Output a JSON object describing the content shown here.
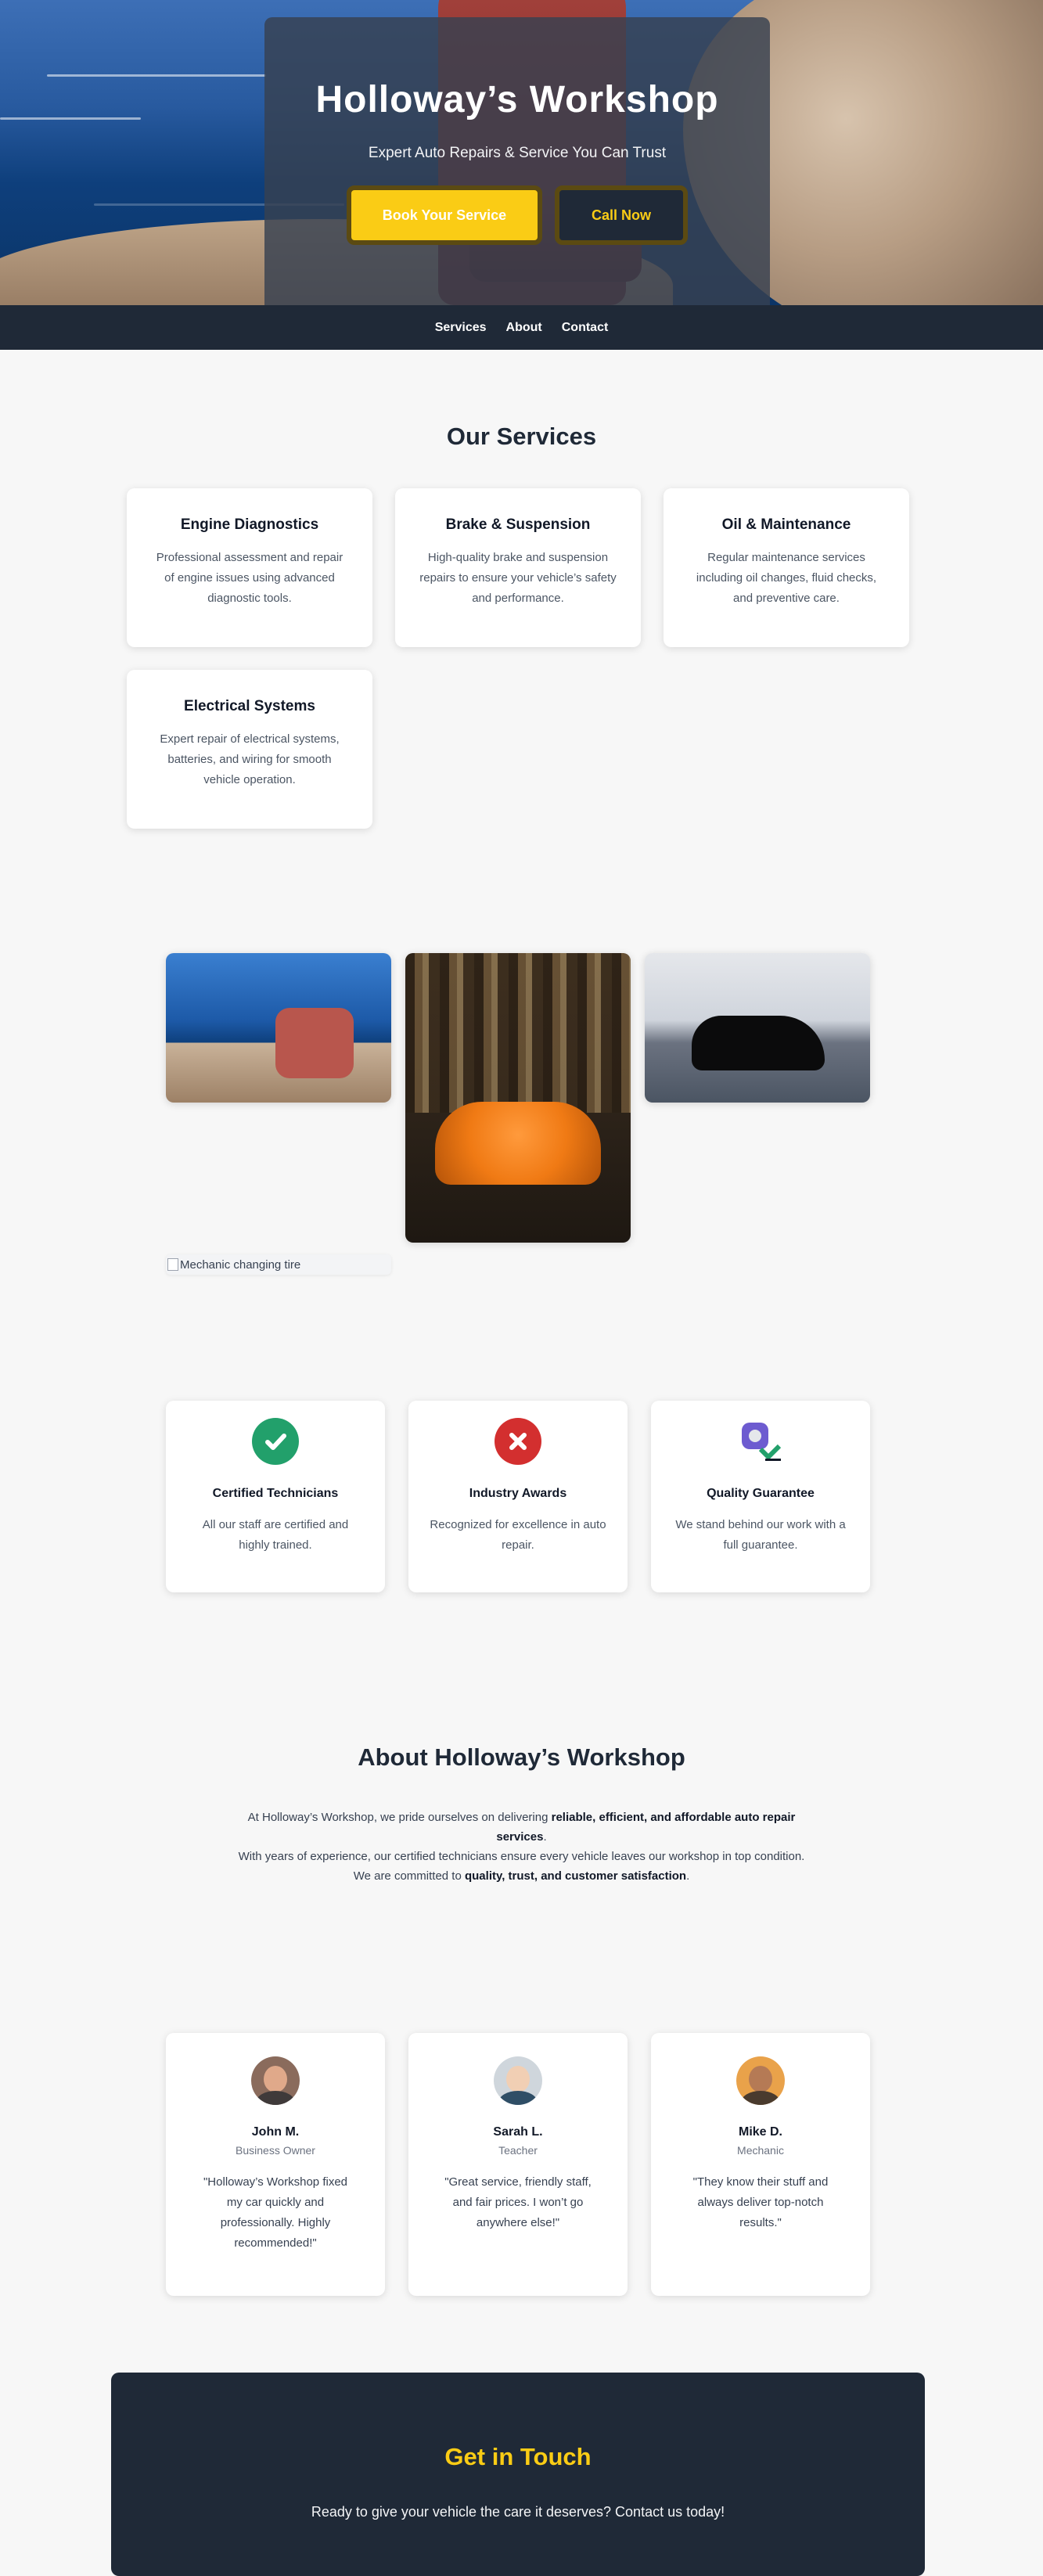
{
  "hero": {
    "title": "Holloway’s Workshop",
    "subtitle": "Expert Auto Repairs & Service You Can Trust",
    "book_label": "Book Your Service",
    "call_label": "Call Now"
  },
  "nav": {
    "items": [
      "Services",
      "About",
      "Contact"
    ]
  },
  "services": {
    "title": "Our Services",
    "items": [
      {
        "title": "Engine Diagnostics",
        "desc": "Professional assessment and repair of engine issues using advanced diagnostic tools."
      },
      {
        "title": "Brake & Suspension",
        "desc": "High-quality brake and suspension repairs to ensure your vehicle’s safety and performance."
      },
      {
        "title": "Oil & Maintenance",
        "desc": "Regular maintenance services including oil changes, fluid checks, and preventive care."
      },
      {
        "title": "Electrical Systems",
        "desc": "Expert repair of electrical systems, batteries, and wiring for smooth vehicle operation."
      }
    ]
  },
  "gallery": {
    "broken_alt": "Mechanic changing tire"
  },
  "features": [
    {
      "title": "Certified Technicians",
      "desc": "All our staff are certified and highly trained.",
      "icon": "check-icon",
      "color": "#22a06b"
    },
    {
      "title": "Industry Awards",
      "desc": "Recognized for excellence in auto repair.",
      "icon": "x-icon",
      "color": "#d32f2f"
    },
    {
      "title": "Quality Guarantee",
      "desc": "We stand behind our work with a full guarantee.",
      "icon": "guarantee-icon",
      "color": "#6d5bd0"
    }
  ],
  "about": {
    "title": "About Holloway’s Workshop",
    "p1_pre": "At Holloway’s Workshop, we pride ourselves on delivering ",
    "p1_bold": "reliable, efficient, and affordable auto repair services",
    "p1_post": ".",
    "p2": "With years of experience, our certified technicians ensure every vehicle leaves our workshop in top condition.",
    "p3_pre": "We are committed to ",
    "p3_bold": "quality, trust, and customer satisfaction",
    "p3_post": "."
  },
  "testimonials": [
    {
      "name": "John M.",
      "role": "Business Owner",
      "quote": "\"Holloway’s Workshop fixed my car quickly and professionally. Highly recommended!\""
    },
    {
      "name": "Sarah L.",
      "role": "Teacher",
      "quote": "\"Great service, friendly staff, and fair prices. I won’t go anywhere else!\""
    },
    {
      "name": "Mike D.",
      "role": "Mechanic",
      "quote": "\"They know their stuff and always deliver top-notch results.\""
    }
  ],
  "contact": {
    "title": "Get in Touch",
    "text": "Ready to give your vehicle the care it deserves? Contact us today!"
  },
  "colors": {
    "accent": "#facc15",
    "dark": "#1f2937",
    "background": "#f7f7f7"
  }
}
